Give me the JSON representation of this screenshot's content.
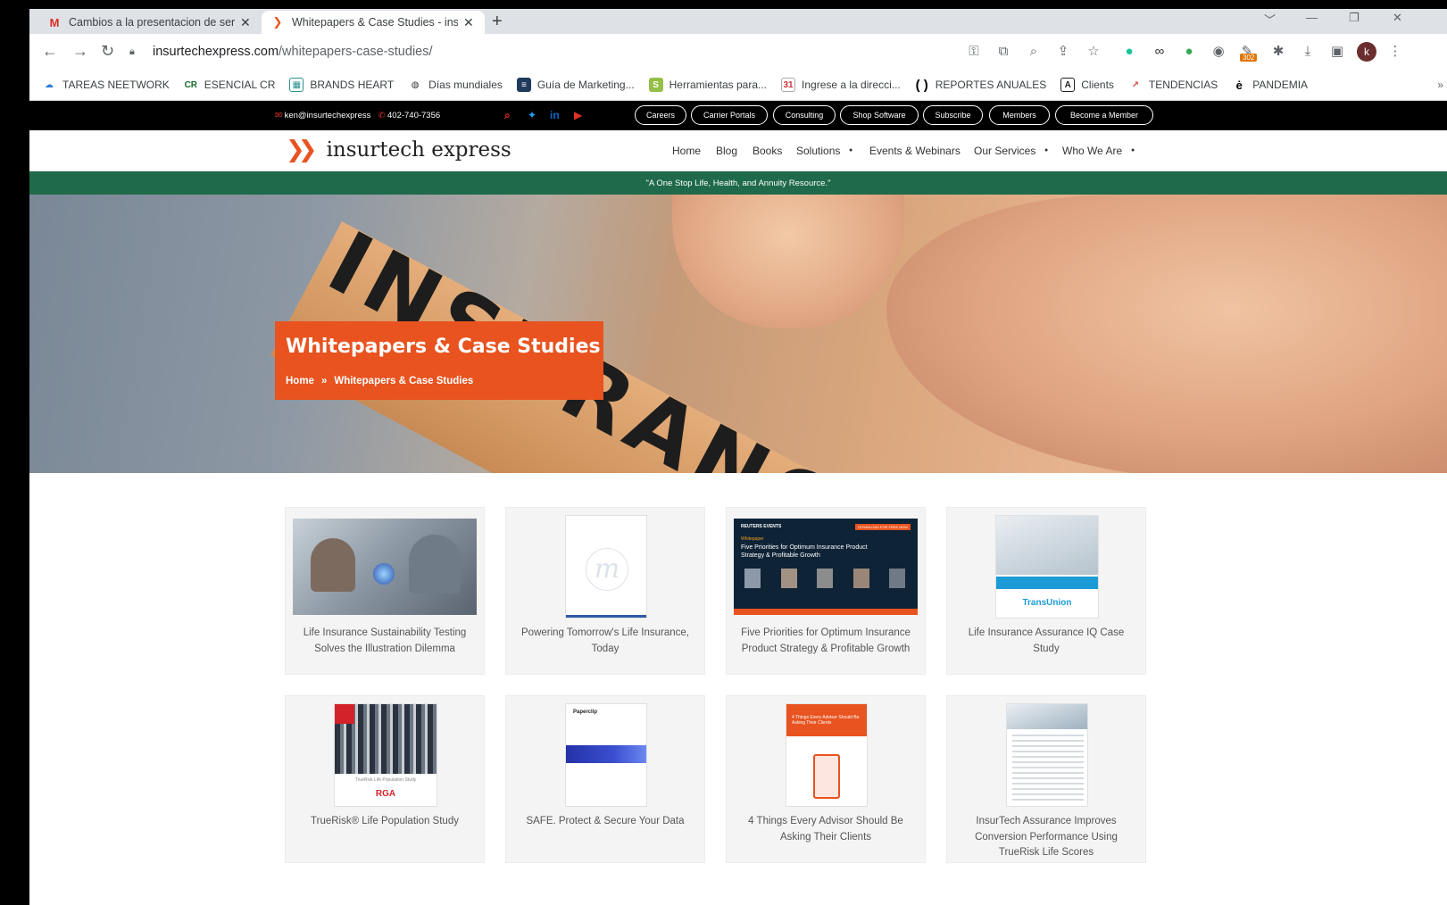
{
  "browser": {
    "tabs": [
      {
        "label": "Cambios a la presentacion de ser",
        "favicon": "gmail-icon",
        "active": false
      },
      {
        "label": "Whitepapers & Case Studies - ins",
        "favicon": "insurtech-favicon",
        "active": true
      }
    ],
    "url_host": "insurtechexpress.com",
    "url_path": "/whitepapers-case-studies/",
    "extension_badge": "302",
    "avatar_letter": "k",
    "bookmarks": [
      {
        "label": "TAREAS NEETWORK",
        "icon": "cloud-icon"
      },
      {
        "label": "ESENCIAL CR",
        "icon": "cr-icon"
      },
      {
        "label": "BRANDS HEART",
        "icon": "brands-heart-icon"
      },
      {
        "label": "Días mundiales",
        "icon": "globe-icon"
      },
      {
        "label": "Guía de Marketing...",
        "icon": "document-icon"
      },
      {
        "label": "Herramientas para...",
        "icon": "shopify-icon"
      },
      {
        "label": "Ingrese a la direcci...",
        "icon": "calendar-icon"
      },
      {
        "label": "REPORTES ANUALES",
        "icon": "bracket-icon"
      },
      {
        "label": "Clients",
        "icon": "clients-icon"
      },
      {
        "label": "TENDENCIAS",
        "icon": "trend-icon"
      },
      {
        "label": "PANDEMIA",
        "icon": "e-icon"
      }
    ],
    "bookmarks_more": "»"
  },
  "site": {
    "topbar": {
      "email": "ken@insurtechexpress",
      "phone": "402-740-7356",
      "social": [
        "search-icon",
        "twitter-icon",
        "linkedin-icon",
        "youtube-icon"
      ],
      "pills": [
        "Careers",
        "Carrier Portals",
        "Consulting",
        "Shop Software",
        "Subscribe",
        "Members",
        "Become a Member"
      ]
    },
    "logo_text": "insurtech express",
    "nav": [
      "Home",
      "Blog",
      "Books",
      "Solutions",
      "Events & Webinars",
      "Our Services",
      "Who We Are"
    ],
    "nav_dropdown": [
      false,
      false,
      false,
      true,
      false,
      true,
      true
    ],
    "tagline": "\"A One Stop Life, Health, and Annuity Resource.\"",
    "hero": {
      "stamp_text": "INSURANC",
      "title": "Whitepapers & Case Studies",
      "breadcrumb_home": "Home",
      "breadcrumb_sep": "»",
      "breadcrumb_current": "Whitepapers & Case Studies"
    },
    "cards": [
      {
        "title": "Life Insurance Sustainability Testing Solves the Illustration Dilemma"
      },
      {
        "title": "Powering Tomorrow's Life Insurance, Today"
      },
      {
        "title": "Five Priorities for Optimum Insurance Product Strategy & Profitable Growth"
      },
      {
        "title": "Life Insurance Assurance IQ Case Study"
      },
      {
        "title": "TrueRisk® Life Population Study"
      },
      {
        "title": "SAFE. Protect & Secure Your Data"
      },
      {
        "title": "4 Things Every Advisor Should Be Asking Their Clients"
      },
      {
        "title": "InsurTech Assurance Improves Conversion Performance Using TrueRisk Life Scores"
      }
    ],
    "thumb_text": {
      "reuters": "REUTERS EVENTS",
      "reuters_sub": "Whitepaper",
      "reuters_title": "Five Priorities for Optimum Insurance Product Strategy & Profitable Growth",
      "reuters_cta": "DOWNLOAD FOR FREE NOW",
      "transunion": "TransUnion",
      "rga_caption": "TrueRisk Life Population Study",
      "rga": "RGA",
      "paperclip": "Paperclip",
      "advisor": "4 Things Every Advisor Should Be Asking Their Clients"
    }
  },
  "colors": {
    "accent_orange": "#e8531f",
    "band_green": "#1e6a4a",
    "topbar_black": "#000000"
  }
}
